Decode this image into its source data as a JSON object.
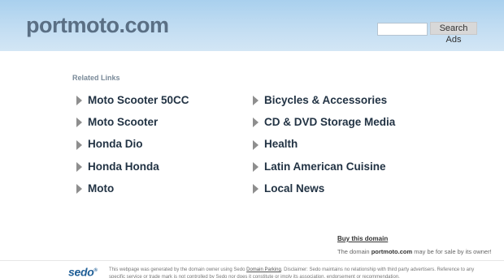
{
  "header": {
    "site_title": "portmoto.com",
    "search": {
      "value": "",
      "placeholder": ""
    },
    "search_button_label": "Search Ads"
  },
  "related": {
    "heading": "Related Links",
    "left": [
      {
        "label": "Moto Scooter 50CC"
      },
      {
        "label": "Moto Scooter"
      },
      {
        "label": "Honda Dio"
      },
      {
        "label": "Honda Honda"
      },
      {
        "label": "Moto"
      }
    ],
    "right": [
      {
        "label": "Bicycles & Accessories"
      },
      {
        "label": "CD & DVD Storage Media"
      },
      {
        "label": "Health"
      },
      {
        "label": "Latin American Cuisine"
      },
      {
        "label": "Local News"
      }
    ]
  },
  "buy": {
    "link_label": "Buy this domain",
    "sale_prefix": "The domain",
    "domain": "portmoto.com",
    "sale_suffix": "may be for sale by its owner!"
  },
  "footer": {
    "logo_text": "sedo",
    "logo_mark": "®",
    "disclaimer_part1": "This webpage was generated by the domain owner using Sedo",
    "parking_link": "Domain Parking",
    "disclaimer_part2": ". Disclaimer: Sedo maintains no relationship with third party advertisers. Reference to any specific service or trade mark is not controlled by Sedo nor does it constitute or imply its association, endorsement or recommendation."
  }
}
